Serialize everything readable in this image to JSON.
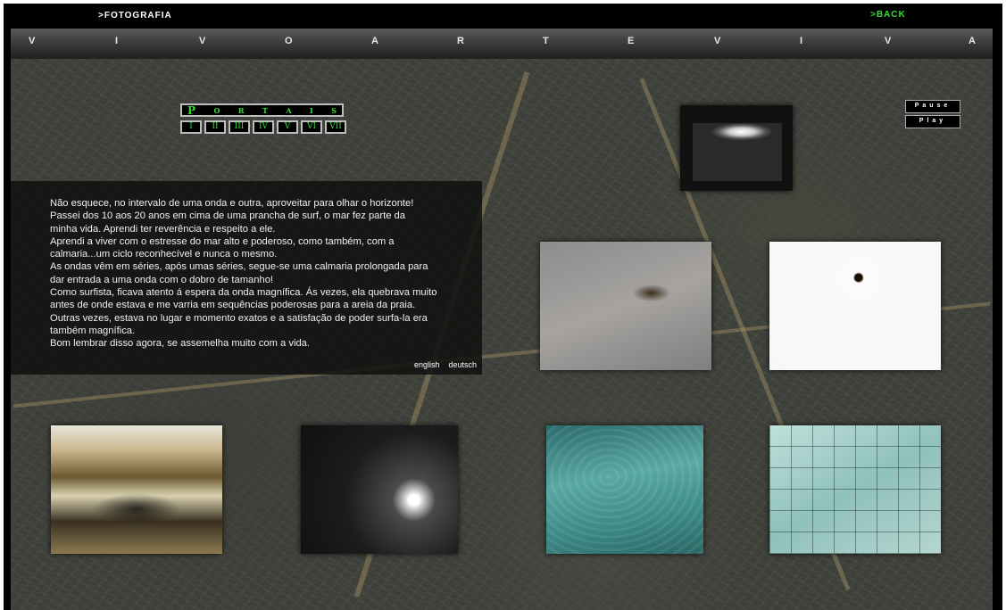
{
  "header": {
    "section": ">FOTOGRAFIA",
    "back": ">BACK"
  },
  "title_letters": [
    "V",
    "I",
    "V",
    "O",
    "A",
    "R",
    "T",
    "E",
    "V",
    "I",
    "V",
    "A"
  ],
  "portais": {
    "title_letters": [
      "P",
      "O",
      "R",
      "T",
      "A",
      "I",
      "S"
    ],
    "buttons": [
      "I",
      "II",
      "III",
      "IV",
      "V",
      "VI",
      "VII"
    ]
  },
  "controls": {
    "pause": "Pause",
    "play": "Play"
  },
  "text": {
    "lines": [
      "Não esquece, no intervalo de uma onda e outra, aproveitar para olhar o horizonte!",
      "Passei  dos 10 aos 20 anos em cima de uma prancha de surf, o mar fez parte da",
      "minha vida. Aprendi ter reverência e respeito a ele.",
      "Aprendi a viver com o estresse do mar alto e poderoso, como também, com a",
      "calmaria...um ciclo reconhecível e nunca o mesmo.",
      "As ondas vêm em séries, após umas séries, segue-se uma calmaria prolongada para",
      "dar entrada a uma onda com o dobro de tamanho!",
      "Como surfista, ficava atento á espera da onda magnífica. Ás vezes, ela quebrava muito",
      "antes de onde estava e me varria em sequências poderosas para a areia da praia.",
      "Outras vezes, estava no lugar e momento exatos e a satisfação de poder surfa-la era",
      "também magnífica.",
      "Bom lembrar disso agora, se assemelha muito com a vida."
    ],
    "languages": [
      "english",
      "deutsch"
    ]
  },
  "colors": {
    "accent_green": "#33dd33",
    "background": "#000000",
    "text_panel": "#0f0f0f"
  }
}
